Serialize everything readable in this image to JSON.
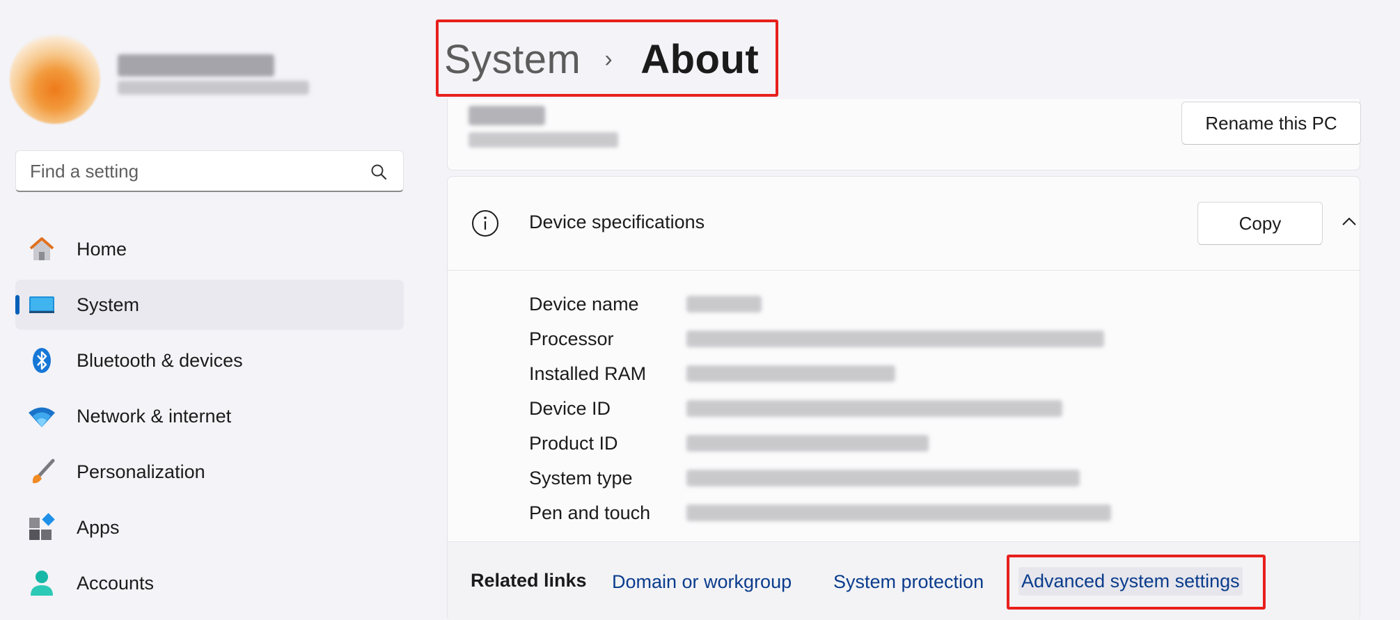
{
  "sidebar": {
    "search_placeholder": "Find a setting",
    "items": [
      {
        "label": "Home",
        "icon": "home-icon"
      },
      {
        "label": "System",
        "icon": "system-icon",
        "active": true
      },
      {
        "label": "Bluetooth & devices",
        "icon": "bluetooth-icon"
      },
      {
        "label": "Network & internet",
        "icon": "wifi-icon"
      },
      {
        "label": "Personalization",
        "icon": "brush-icon"
      },
      {
        "label": "Apps",
        "icon": "apps-icon"
      },
      {
        "label": "Accounts",
        "icon": "accounts-icon"
      }
    ]
  },
  "header": {
    "parent": "System",
    "separator": "›",
    "current": "About"
  },
  "pc_card": {
    "rename_label": "Rename this PC"
  },
  "specs": {
    "title": "Device specifications",
    "copy_label": "Copy",
    "rows": [
      {
        "label": "Device name"
      },
      {
        "label": "Processor"
      },
      {
        "label": "Installed RAM"
      },
      {
        "label": "Device ID"
      },
      {
        "label": "Product ID"
      },
      {
        "label": "System type"
      },
      {
        "label": "Pen and touch"
      }
    ]
  },
  "related": {
    "label": "Related links",
    "links": [
      "Domain or workgroup",
      "System protection",
      "Advanced system settings"
    ]
  },
  "colors": {
    "accent": "#005fb8",
    "link": "#0a3c8c",
    "highlight": "#e8201d"
  }
}
